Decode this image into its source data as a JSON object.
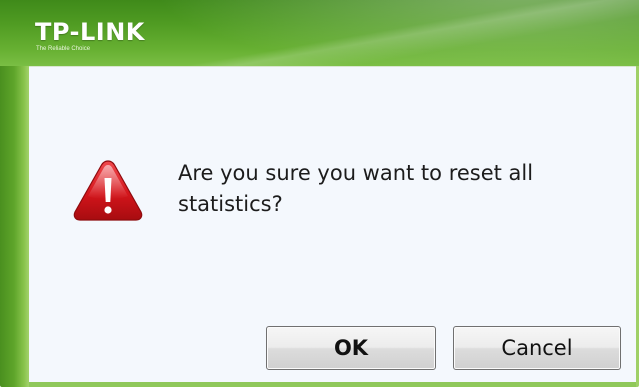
{
  "header": {
    "brand": "TP-LINK",
    "tagline": "The Reliable Choice"
  },
  "dialog": {
    "message": "Are you sure you want to reset all statistics?",
    "icon": "warning-icon",
    "ok_label": "OK",
    "cancel_label": "Cancel"
  },
  "colors": {
    "brand_green": "#4f9b22",
    "panel_background": "#f4f8fd",
    "warning_red": "#d4151b"
  }
}
